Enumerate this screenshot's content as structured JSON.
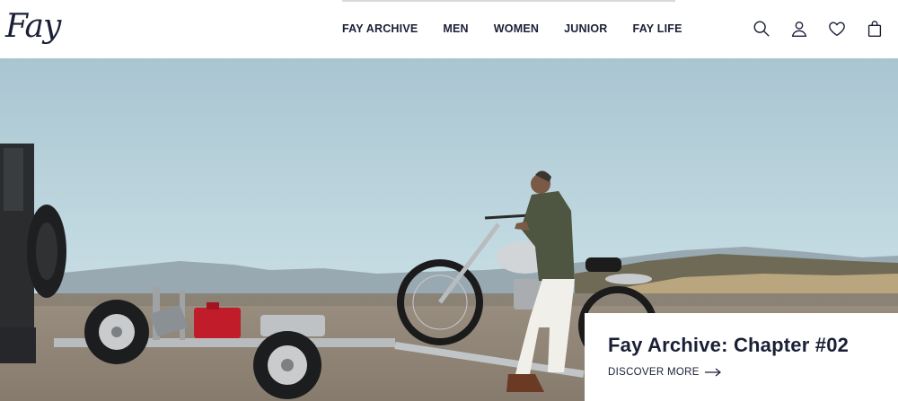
{
  "brand": {
    "logo_text": "Fay"
  },
  "nav": {
    "items": [
      {
        "label": "FAY ARCHIVE"
      },
      {
        "label": "MEN"
      },
      {
        "label": "WOMEN"
      },
      {
        "label": "JUNIOR"
      },
      {
        "label": "FAY LIFE"
      }
    ]
  },
  "header_icons": [
    "search-icon",
    "account-icon",
    "wishlist-heart-icon",
    "shopping-bag-icon"
  ],
  "hero": {
    "title": "Fay Archive: Chapter #02",
    "cta_label": "DISCOVER MORE"
  },
  "colors": {
    "text": "#1a1f36",
    "sky": "#b9d3dc",
    "sand": "#8f8577"
  }
}
